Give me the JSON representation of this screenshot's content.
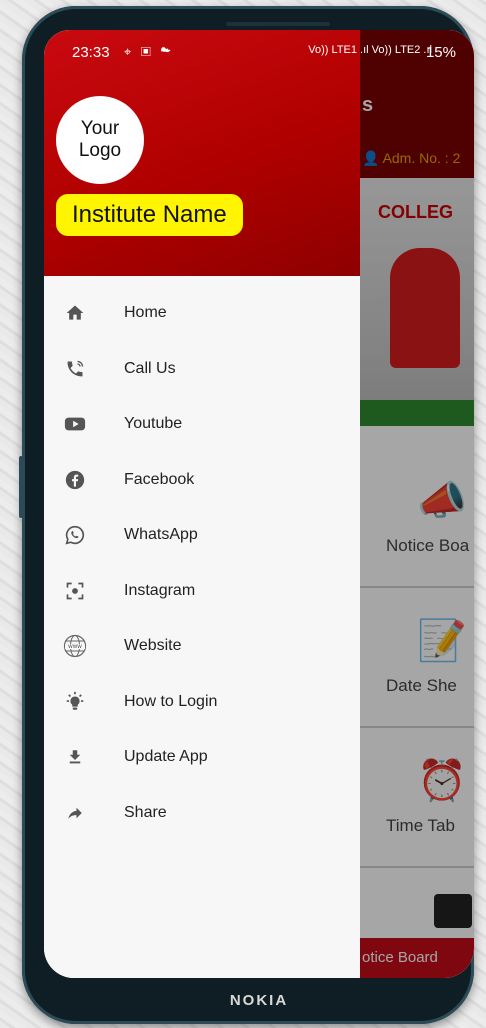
{
  "status_bar": {
    "time": "23:33",
    "left_icons": "⌖ ▣ ☁",
    "network": "Vo)) LTE1 .ıl Vo)) LTE2 .ıl",
    "battery": "15%"
  },
  "drawer": {
    "logo_line1": "Your",
    "logo_line2": "Logo",
    "institute_name": "Institute Name",
    "items": [
      {
        "label": "Home",
        "icon": "home-icon"
      },
      {
        "label": "Call Us",
        "icon": "phone-icon"
      },
      {
        "label": "Youtube",
        "icon": "youtube-icon"
      },
      {
        "label": "Facebook",
        "icon": "facebook-icon"
      },
      {
        "label": "WhatsApp",
        "icon": "whatsapp-icon"
      },
      {
        "label": "Instagram",
        "icon": "instagram-icon"
      },
      {
        "label": "Website",
        "icon": "globe-icon"
      },
      {
        "label": "How to Login",
        "icon": "lightbulb-icon"
      },
      {
        "label": "Update App",
        "icon": "download-icon"
      },
      {
        "label": "Share",
        "icon": "share-icon"
      }
    ]
  },
  "background_app": {
    "title": "s",
    "adm_no": "Adm. No. : 2",
    "banner_text": "COLLEG",
    "cards": [
      {
        "label": "Notice Boa"
      },
      {
        "label": "Date She"
      },
      {
        "label": "Time Tab"
      }
    ],
    "bottom_bar": "otice Board"
  },
  "device": {
    "brand": "NOKIA"
  },
  "colors": {
    "header_red": "#c90a10",
    "institute_badge": "#fff500",
    "bottom_bar": "#c40d1a"
  }
}
